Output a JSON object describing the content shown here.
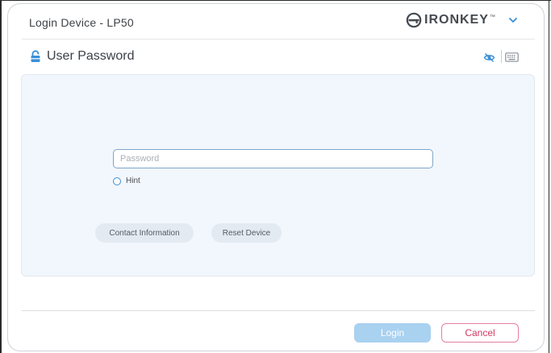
{
  "window": {
    "title": "Login Device - LP50"
  },
  "brand": {
    "name": "IRONKEY",
    "trademark": "™",
    "logo_icon": "ironkey-logo-icon",
    "menu_icon": "chevron-down-icon"
  },
  "section": {
    "title": "User Password",
    "icon": "lock-icon",
    "tools": {
      "visibility_icon": "eye-slash-icon",
      "keyboard_icon": "keyboard-icon"
    }
  },
  "form": {
    "password": {
      "value": "",
      "placeholder": "Password"
    },
    "hint_label": "Hint"
  },
  "actions": {
    "contact_label": "Contact Information",
    "reset_label": "Reset Device",
    "login_label": "Login",
    "cancel_label": "Cancel"
  },
  "colors": {
    "accent": "#3b8ed6",
    "login_button": "#a9d1f0",
    "cancel_text": "#d03a62",
    "panel_background": "#f2f7fd"
  }
}
